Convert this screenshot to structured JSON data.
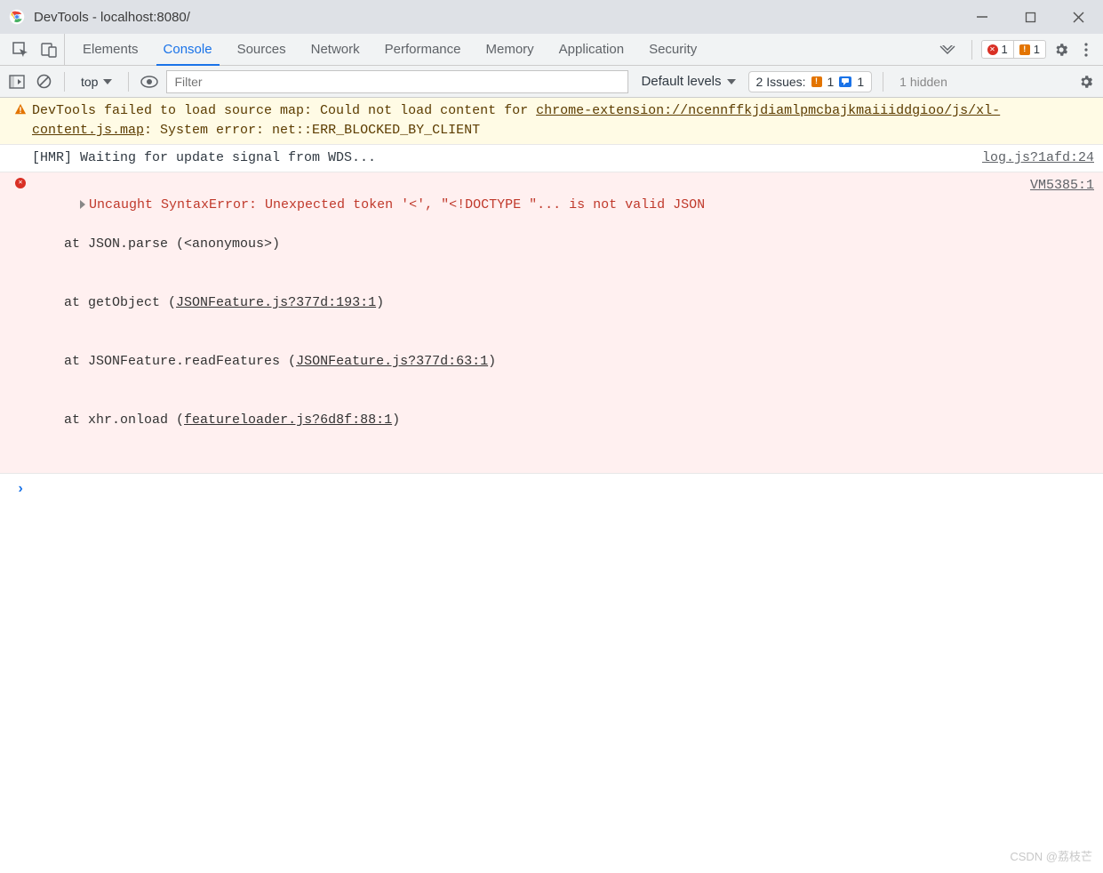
{
  "window": {
    "title": "DevTools - localhost:8080/",
    "controls": {
      "min": "—",
      "close": "✕"
    }
  },
  "tabs": {
    "items": [
      "Elements",
      "Console",
      "Sources",
      "Network",
      "Performance",
      "Memory",
      "Application",
      "Security"
    ],
    "active_index": 1
  },
  "toolbar": {
    "error_count": "1",
    "warning_count": "1"
  },
  "filterbar": {
    "context": "top",
    "filter_placeholder": "Filter",
    "levels_label": "Default levels",
    "issues_label": "2 Issues:",
    "issues_warn": "1",
    "issues_info": "1",
    "hidden_label": "1 hidden"
  },
  "entries": {
    "warn": {
      "text_pre": "DevTools failed to load source map: Could not load content for ",
      "link": "chrome-extension://ncennffkjdiamlpmcbajkmaiiiddgioo/js/xl-content.js.map",
      "text_post": ": System error: net::ERR_BLOCKED_BY_CLIENT"
    },
    "log": {
      "text": "[HMR] Waiting for update signal from WDS...",
      "source": "log.js?1afd:24"
    },
    "err": {
      "message": "Uncaught SyntaxError: Unexpected token '<', \"<!DOCTYPE \"... is not valid JSON",
      "source": "VM5385:1",
      "stack": [
        {
          "pre": "    at JSON.parse (<anonymous>)",
          "link": ""
        },
        {
          "pre": "    at getObject (",
          "link": "JSONFeature.js?377d:193:1",
          "post": ")"
        },
        {
          "pre": "    at JSONFeature.readFeatures (",
          "link": "JSONFeature.js?377d:63:1",
          "post": ")"
        },
        {
          "pre": "    at xhr.onload (",
          "link": "featureloader.js?6d8f:88:1",
          "post": ")"
        }
      ]
    }
  },
  "watermark": "CSDN @荔枝芒"
}
